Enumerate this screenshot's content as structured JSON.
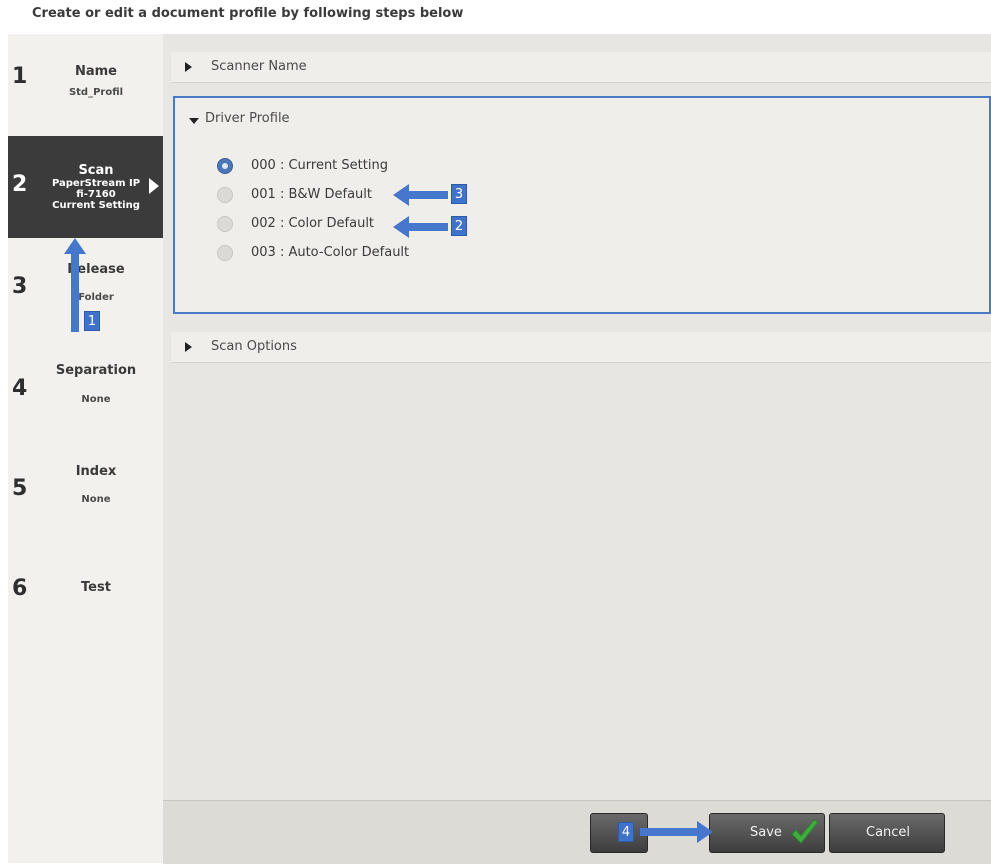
{
  "header": {
    "title": "Create or edit a document profile by following steps below"
  },
  "steps": [
    {
      "num": "1",
      "label": "Name",
      "value_lines": [
        "Std_Profil"
      ]
    },
    {
      "num": "2",
      "label": "Scan",
      "value_lines": [
        "PaperStream IP",
        "fi-7160",
        "Current Setting"
      ]
    },
    {
      "num": "3",
      "label": "Release",
      "value_lines": [
        "Folder"
      ]
    },
    {
      "num": "4",
      "label": "Separation",
      "value_lines": [
        "None"
      ]
    },
    {
      "num": "5",
      "label": "Index",
      "value_lines": [
        "None"
      ]
    },
    {
      "num": "6",
      "label": "Test",
      "value_lines": []
    }
  ],
  "active_step": 2,
  "panels": {
    "scanner_name": "Scanner Name",
    "driver_profile": "Driver Profile",
    "scan_options": "Scan Options"
  },
  "driver_options": [
    {
      "label": "000 : Current Setting",
      "selected": true
    },
    {
      "label": "001 : B&W Default",
      "selected": false
    },
    {
      "label": "002 : Color Default",
      "selected": false
    },
    {
      "label": "003 : Auto-Color Default",
      "selected": false
    }
  ],
  "buttons": {
    "save": "Save",
    "cancel": "Cancel"
  },
  "callouts": {
    "one": "1",
    "two": "2",
    "three": "3",
    "four": "4"
  },
  "colors": {
    "accent": "#4577cc",
    "active_step_bg": "#3b3b3b",
    "panel_border": "#4a79c6",
    "save_check": "#3fae3f"
  }
}
